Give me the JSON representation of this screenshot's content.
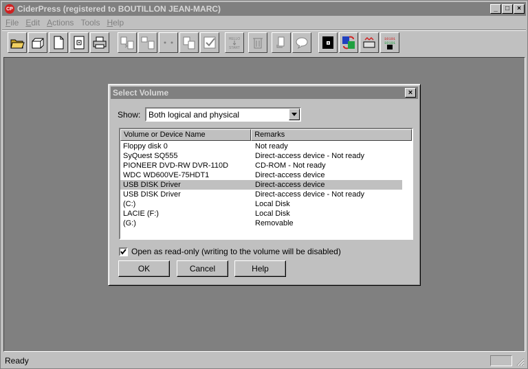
{
  "app": {
    "title": "CiderPress  (registered to BOUTILLON JEAN-MARC)",
    "icon_text": "CP"
  },
  "window_controls": {
    "minimize": "_",
    "maximize": "□",
    "close": "×"
  },
  "menu": [
    {
      "label": "File",
      "key": "F",
      "rest": "ile"
    },
    {
      "label": "Edit",
      "key": "E",
      "rest": "dit"
    },
    {
      "label": "Actions",
      "key": "A",
      "rest": "ctions"
    },
    {
      "label": "Tools",
      "key": "",
      "rest": "Tools"
    },
    {
      "label": "Help",
      "key": "H",
      "rest": "elp"
    }
  ],
  "toolbar": {
    "buttons": [
      "open-archive-icon",
      "open-volume-icon",
      "new-archive-icon",
      "open-disk-image-icon",
      "print-icon",
      "add-files-icon",
      "add-disk-icon",
      "view-icon",
      "extract-icon",
      "test-icon",
      "hello-start-icon",
      "delete-icon",
      "rename-icon",
      "comment-icon",
      "disk-editor-icon",
      "convert-icon",
      "volume-copier-icon",
      "binary-icon"
    ],
    "hello_text": "HELLO",
    "start_text": "START",
    "binary_text": "10101"
  },
  "status": {
    "text": "Ready"
  },
  "dialog": {
    "title": "Select Volume",
    "show_label": "Show:",
    "show_value": "Both logical and physical",
    "columns": [
      "Volume or Device Name",
      "Remarks"
    ],
    "rows": [
      {
        "name": "Floppy disk 0",
        "remarks": "Not ready",
        "selected": false
      },
      {
        "name": "SyQuest SQ555",
        "remarks": "Direct-access device - Not ready",
        "selected": false
      },
      {
        "name": "PIONEER DVD-RW  DVR-110D",
        "remarks": "CD-ROM - Not ready",
        "selected": false
      },
      {
        "name": "WDC WD600VE-75HDT1",
        "remarks": "Direct-access device",
        "selected": false
      },
      {
        "name": " USB DISK Driver",
        "remarks": "Direct-access device",
        "selected": true
      },
      {
        "name": " USB DISK Driver",
        "remarks": "Direct-access device - Not ready",
        "selected": false
      },
      {
        "name": " (C:)",
        "remarks": "Local Disk",
        "selected": false
      },
      {
        "name": "LACIE (F:)",
        "remarks": "Local Disk",
        "selected": false
      },
      {
        "name": " (G:)",
        "remarks": "Removable",
        "selected": false
      }
    ],
    "readonly_checked": true,
    "readonly_label": "Open as read-only (writing to the volume will be disabled)",
    "ok_label": "OK",
    "cancel_label": "Cancel",
    "help_label": "Help"
  }
}
